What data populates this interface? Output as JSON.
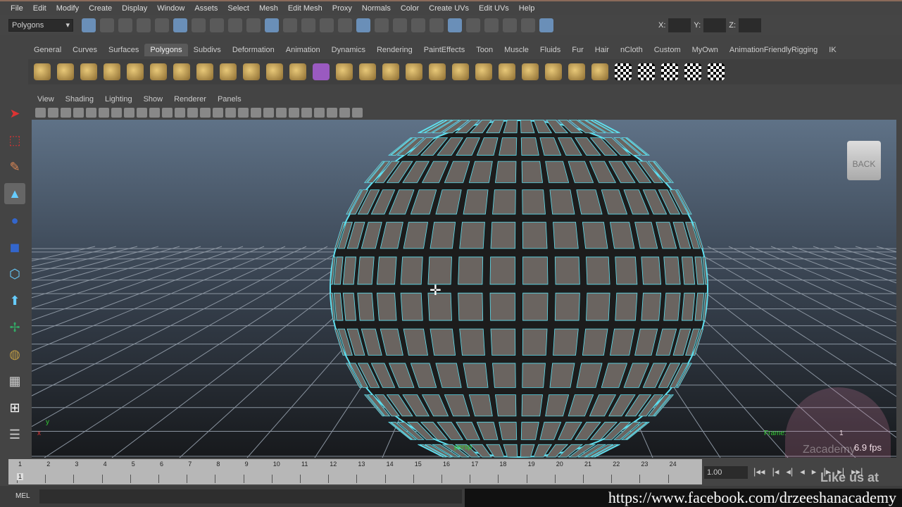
{
  "menu": [
    "File",
    "Edit",
    "Modify",
    "Create",
    "Display",
    "Window",
    "Assets",
    "Select",
    "Mesh",
    "Edit Mesh",
    "Proxy",
    "Normals",
    "Color",
    "Create UVs",
    "Edit UVs",
    "Help"
  ],
  "status": {
    "mode": "Polygons",
    "x_label": "X:",
    "y_label": "Y:",
    "z_label": "Z:"
  },
  "shelf_tabs": [
    "General",
    "Curves",
    "Surfaces",
    "Polygons",
    "Subdivs",
    "Deformation",
    "Animation",
    "Dynamics",
    "Rendering",
    "PaintEffects",
    "Toon",
    "Muscle",
    "Fluids",
    "Fur",
    "Hair",
    "nCloth",
    "Custom",
    "MyOwn",
    "AnimationFriendlyRigging",
    "IK"
  ],
  "active_tab": "Polygons",
  "panel_menu": [
    "View",
    "Shading",
    "Lighting",
    "Show",
    "Renderer",
    "Panels"
  ],
  "viewcube_label": "BACK",
  "hud": {
    "frame_label": "Frame:",
    "frame_value": "1",
    "fps": "6.9 fps",
    "persp": "persp",
    "axis_x": "x",
    "axis_y": "y"
  },
  "timeline": {
    "ticks": [
      "1",
      "2",
      "3",
      "4",
      "5",
      "6",
      "7",
      "8",
      "9",
      "10",
      "11",
      "12",
      "13",
      "14",
      "15",
      "16",
      "17",
      "18",
      "19",
      "20",
      "21",
      "22",
      "23",
      "24"
    ],
    "current": "1",
    "current_frame_field": "1.00"
  },
  "command_line_label": "MEL",
  "watermark": {
    "url": "https://www.facebook.com/drzeeshanacademy",
    "like": "Like us at",
    "brand": "Zacademy"
  },
  "colors": {
    "wire": "#5fe0f0",
    "face": "#6a6460",
    "accent": "#5a5a5a"
  }
}
